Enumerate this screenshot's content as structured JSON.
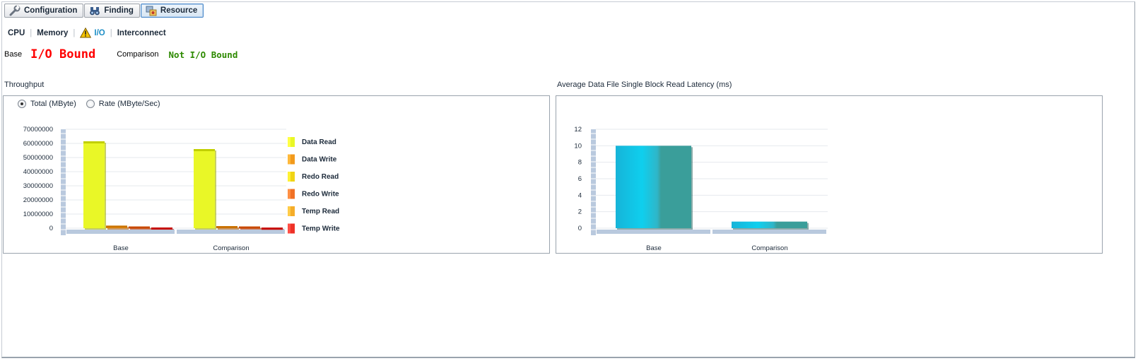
{
  "tabs": [
    {
      "label": "Configuration",
      "icon": "wrench-icon",
      "active": false
    },
    {
      "label": "Finding",
      "icon": "binoculars-icon",
      "active": false
    },
    {
      "label": "Resource",
      "icon": "resource-icon",
      "active": true
    }
  ],
  "subnav": {
    "cpu": "CPU",
    "memory": "Memory",
    "io": "I/O",
    "interconnect": "Interconnect"
  },
  "status": {
    "base_label": "Base",
    "base_value": "I/O Bound",
    "comparison_label": "Comparison",
    "comparison_value": "Not I/O Bound"
  },
  "throughput": {
    "title": "Throughput",
    "radio_total": "Total (MByte)",
    "radio_rate": "Rate (MByte/Sec)",
    "selected": "total"
  },
  "latency": {
    "title": "Average Data File Single Block Read Latency (ms)"
  },
  "chart_data": [
    {
      "type": "bar",
      "categories": [
        "Base",
        "Comparison"
      ],
      "ylim": [
        0,
        70000000
      ],
      "yticks": [
        "0",
        "10000000",
        "20000000",
        "30000000",
        "40000000",
        "50000000",
        "60000000",
        "70000000"
      ],
      "series": [
        {
          "name": "Data Read",
          "color": "#e9f727",
          "values": [
            61500000,
            56000000
          ]
        },
        {
          "name": "Data Write",
          "color": "#f29a1c",
          "values": [
            1800000,
            1500000
          ]
        },
        {
          "name": "Redo Read",
          "color": "#f0d416",
          "values": [
            0,
            0
          ]
        },
        {
          "name": "Redo Write",
          "color": "#f07126",
          "values": [
            1200000,
            1200000
          ]
        },
        {
          "name": "Temp Read",
          "color": "#f5ad2a",
          "values": [
            0,
            0
          ]
        },
        {
          "name": "Temp Write",
          "color": "#ee3127",
          "values": [
            500000,
            400000
          ]
        }
      ],
      "legend": "right"
    },
    {
      "type": "bar",
      "categories": [
        "Base",
        "Comparison"
      ],
      "ylim": [
        0,
        12
      ],
      "yticks": [
        "0",
        "2",
        "4",
        "6",
        "8",
        "10",
        "12"
      ],
      "series": [
        {
          "values": [
            10,
            0.8
          ],
          "color": "#3a9e9a"
        }
      ]
    }
  ]
}
